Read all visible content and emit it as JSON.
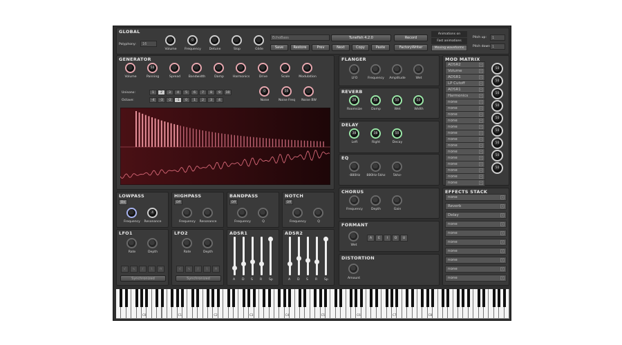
{
  "global": {
    "title": "GLOBAL",
    "polyphony_label": "Polyphony:",
    "polyphony_value": "16",
    "knobs": [
      {
        "label": "Volume",
        "value": ""
      },
      {
        "label": "Frequency",
        "value": "0"
      },
      {
        "label": "Detune",
        "value": ""
      },
      {
        "label": "Slop",
        "value": ""
      },
      {
        "label": "Glide",
        "value": ""
      }
    ],
    "preset_name": "EchoBass",
    "version_label": "Tunefish 4.2.0",
    "record_label": "Record",
    "buttons": [
      "Save",
      "Restore",
      "Prev",
      "Next",
      "Copy",
      "Paste",
      "FactoryWriter"
    ],
    "anim_options": [
      "Animations on",
      "Fast animations",
      "Moving waveforms"
    ],
    "pitch_up_label": "Pitch up:",
    "pitch_up_value": "1",
    "pitch_down_label": "Pitch down:",
    "pitch_down_value": "1"
  },
  "generator": {
    "title": "GENERATOR",
    "knobs": [
      {
        "label": "Volume",
        "value": ""
      },
      {
        "label": "Panning",
        "value": "50"
      },
      {
        "label": "Spread",
        "value": ""
      },
      {
        "label": "Bandwidth",
        "value": ""
      },
      {
        "label": "Damp",
        "value": ""
      },
      {
        "label": "Harmonics",
        "value": ""
      },
      {
        "label": "Drive",
        "value": ""
      },
      {
        "label": "Scale",
        "value": ""
      },
      {
        "label": "Modulation",
        "value": ""
      }
    ],
    "unisono_label": "Unisono:",
    "unisono_values": [
      "1",
      "2",
      "3",
      "4",
      "5",
      "6",
      "7",
      "8",
      "9",
      "10"
    ],
    "unisono_selected": "2",
    "octave_label": "Octave:",
    "octave_values": [
      "-4",
      "-3",
      "-2",
      "-1",
      "0",
      "1",
      "2",
      "3",
      "4"
    ],
    "octave_selected": "-1",
    "noise_knobs": [
      {
        "label": "Noise",
        "value": "0"
      },
      {
        "label": "Noise Freq",
        "value": "50"
      },
      {
        "label": "Noise BW",
        "value": ""
      }
    ]
  },
  "flanger": {
    "title": "FLANGER",
    "knobs": [
      {
        "label": "LFO"
      },
      {
        "label": "Frequency"
      },
      {
        "label": "Amplitude"
      },
      {
        "label": "Wet"
      }
    ]
  },
  "reverb": {
    "title": "REVERB",
    "knobs": [
      {
        "label": "Roomsize",
        "value": "26"
      },
      {
        "label": "Damp",
        "value": "50"
      },
      {
        "label": "Wet",
        "value": "50"
      },
      {
        "label": "Width",
        "value": "50"
      }
    ]
  },
  "delay": {
    "title": "DELAY",
    "knobs": [
      {
        "label": "Left",
        "value": "38"
      },
      {
        "label": "Right",
        "value": "38"
      },
      {
        "label": "Decay",
        "value": "50"
      }
    ]
  },
  "eq": {
    "title": "EQ",
    "knobs": [
      {
        "label": "-880Hz"
      },
      {
        "label": "880Hz-5khz"
      },
      {
        "label": "5khz-"
      }
    ]
  },
  "chorus": {
    "title": "CHORUS",
    "knobs": [
      {
        "label": "Frequency"
      },
      {
        "label": "Depth"
      },
      {
        "label": "Gain"
      }
    ]
  },
  "formant": {
    "title": "FORMANT",
    "knob_label": "Wet",
    "vowels": [
      "A",
      "E",
      "I",
      "O",
      "U"
    ]
  },
  "distortion": {
    "title": "DISTORTION",
    "knob_label": "Amount"
  },
  "lowpass": {
    "title": "LOWPASS",
    "toggle": "On",
    "knobs": [
      {
        "label": "Frequency"
      },
      {
        "label": "Resonance",
        "value": "4"
      }
    ]
  },
  "highpass": {
    "title": "HIGHPASS",
    "toggle": "Off",
    "knobs": [
      {
        "label": "Frequency"
      },
      {
        "label": "Resonance"
      }
    ]
  },
  "bandpass": {
    "title": "BANDPASS",
    "toggle": "Off",
    "knobs": [
      {
        "label": "Frequency"
      },
      {
        "label": "Q"
      }
    ]
  },
  "notch": {
    "title": "NOTCH",
    "toggle": "Off",
    "knobs": [
      {
        "label": "Frequency"
      },
      {
        "label": "Q"
      }
    ]
  },
  "lfo1": {
    "title": "LFO1",
    "knobs": [
      {
        "label": "Rate"
      },
      {
        "label": "Depth"
      }
    ],
    "sync_label": "Synchronized"
  },
  "lfo2": {
    "title": "LFO2",
    "knobs": [
      {
        "label": "Rate"
      },
      {
        "label": "Depth"
      }
    ],
    "sync_label": "Synchronized"
  },
  "adsr1": {
    "title": "ADSR1",
    "labels": [
      "A",
      "D",
      "S",
      "R",
      "Sp"
    ],
    "levels": [
      0.2,
      0.3,
      0.35,
      0.3,
      0.95
    ]
  },
  "adsr2": {
    "title": "ADSR2",
    "labels": [
      "A",
      "D",
      "S",
      "R",
      "Sp"
    ],
    "levels": [
      0.3,
      0.45,
      0.4,
      0.35,
      0.95
    ]
  },
  "mod_matrix": {
    "title": "MOD MATRIX",
    "rows": [
      {
        "source": "ADSR2",
        "target": "Volume",
        "value": "50"
      },
      {
        "source": "ADSR1",
        "target": "LP Cutoff",
        "value": "50"
      },
      {
        "source": "ADSR1",
        "target": "Harmonics",
        "value": "50"
      },
      {
        "source": "none",
        "target": "none",
        "value": "50"
      },
      {
        "source": "none",
        "target": "none",
        "value": "50"
      },
      {
        "source": "none",
        "target": "none",
        "value": "50"
      },
      {
        "source": "none",
        "target": "none",
        "value": "50"
      },
      {
        "source": "none",
        "target": "none",
        "value": "50"
      },
      {
        "source": "none",
        "target": "none",
        "value": "50"
      },
      {
        "source": "none",
        "target": "none",
        "value": "50"
      }
    ]
  },
  "effects_stack": {
    "title": "EFFECTS STACK",
    "items": [
      "none",
      "Reverb",
      "Delay",
      "none",
      "none",
      "none",
      "none",
      "none",
      "none",
      "none"
    ]
  },
  "keyboard": {
    "octave_labels": [
      "C0",
      "C1",
      "C2",
      "C3",
      "C4",
      "C5",
      "C6",
      "C7",
      "C8"
    ]
  },
  "colors": {
    "pink": "#e8a8b0",
    "green": "#9be8a8",
    "panel": "#3a3a3a",
    "wave_bg": "#3a0e12",
    "wave_line": "#d06070"
  }
}
